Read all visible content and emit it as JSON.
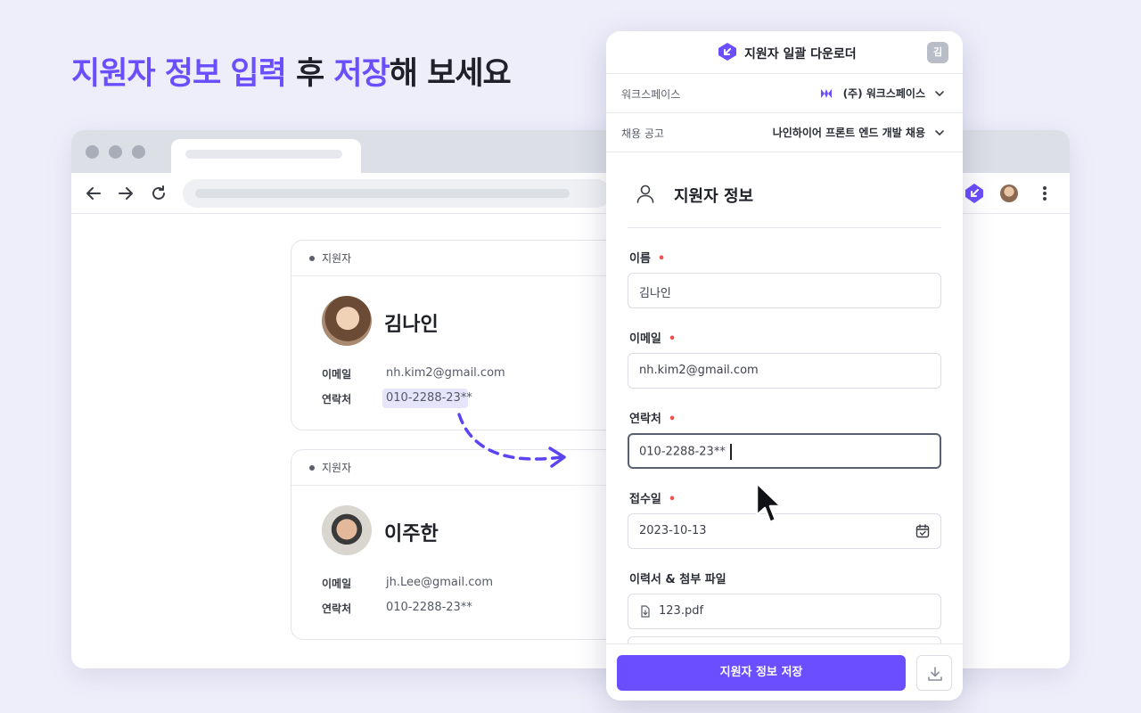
{
  "headline": {
    "part1": "지원자 정보 입력",
    "part2": " 후 ",
    "part3": "저장",
    "part4": "해 보세요"
  },
  "colors": {
    "accent": "#6B4EFF",
    "required": "#F0524D",
    "background": "#EEEEFB"
  },
  "applicants": [
    {
      "tag": "지원자",
      "name": "김나인",
      "email_label": "이메일",
      "email": "nh.kim2@gmail.com",
      "phone_label": "연락처",
      "phone": "010-2288-23**",
      "avatar_icon": "avatar-woman"
    },
    {
      "tag": "지원자",
      "name": "이주한",
      "email_label": "이메일",
      "email": "jh.Lee@gmail.com",
      "phone_label": "연락처",
      "phone": "010-2288-23**",
      "avatar_icon": "avatar-man"
    }
  ],
  "panel": {
    "title": "지원자 일괄 다운로더",
    "user_initial": "김",
    "workspace": {
      "label": "워크스페이스",
      "value": "(주) 워크스페이스"
    },
    "job_posting": {
      "label": "채용 공고",
      "value": "나인하이어 프론트 엔드 개발 채용"
    },
    "section_title": "지원자 정보",
    "fields": {
      "name": {
        "label": "이름",
        "value": "김나인"
      },
      "email": {
        "label": "이메일",
        "value": "nh.kim2@gmail.com"
      },
      "phone": {
        "label": "연락처",
        "value": "010-2288-23**"
      },
      "received_date": {
        "label": "접수일",
        "value": "2023-10-13"
      },
      "attachments": {
        "label": "이력서 & 첨부 파일",
        "files": [
          "123.pdf"
        ]
      }
    },
    "required_mark": "•",
    "save_button": "지원자 정보 저장"
  }
}
